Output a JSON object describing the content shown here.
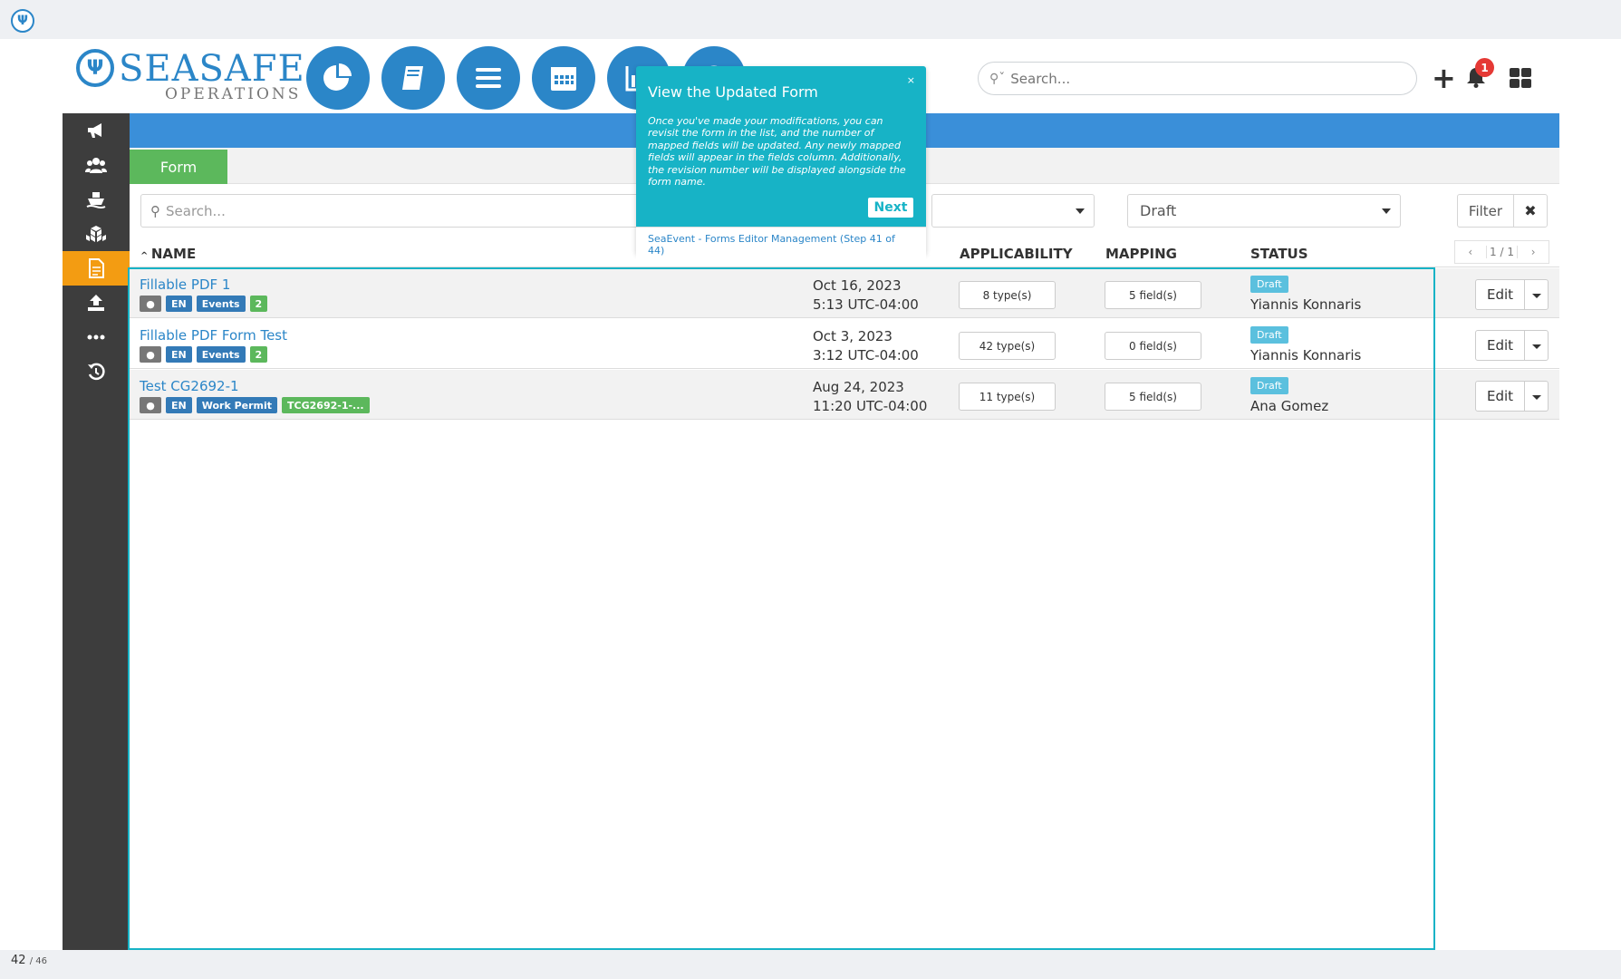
{
  "brand": {
    "name": "SEASAFE",
    "subtitle": "OPERATIONS"
  },
  "icons": [
    "dashboard-pie-icon",
    "book-icon",
    "menu-icon",
    "calendar-icon",
    "chart-icon",
    "clock-icon"
  ],
  "header": {
    "search_placeholder": "Search...",
    "notification_count": "1"
  },
  "sidebar": {
    "items": [
      {
        "icon": "megaphone-icon"
      },
      {
        "icon": "users-icon"
      },
      {
        "icon": "ship-icon"
      },
      {
        "icon": "boxes-icon"
      },
      {
        "icon": "document-icon",
        "active": true
      },
      {
        "icon": "upload-icon"
      },
      {
        "icon": "more-icon"
      },
      {
        "icon": "history-icon"
      }
    ]
  },
  "tabs": {
    "form_label": "Form"
  },
  "filters": {
    "search_placeholder": "Search...",
    "status_value": "Draft",
    "filter_label": "Filter",
    "clear_label": "✖"
  },
  "table": {
    "headers": {
      "name": "NAME",
      "applicability": "APPLICABILITY",
      "mapping": "MAPPING",
      "status": "STATUS"
    },
    "pager": {
      "prev": "‹",
      "page": "1 / 1",
      "next": "›"
    },
    "rows": [
      {
        "name": "Fillable PDF 1",
        "tags": [
          "EN",
          "Events",
          "2"
        ],
        "date": "Oct 16, 2023",
        "time": "5:13 UTC-04:00",
        "applicability": "8 type(s)",
        "mapping": "5 field(s)",
        "status": "Draft",
        "person": "Yiannis Konnaris",
        "edit_label": "Edit"
      },
      {
        "name": "Fillable PDF Form Test",
        "tags": [
          "EN",
          "Events",
          "2"
        ],
        "date": "Oct 3, 2023",
        "time": "3:12 UTC-04:00",
        "applicability": "42 type(s)",
        "mapping": "0 field(s)",
        "status": "Draft",
        "person": "Yiannis Konnaris",
        "edit_label": "Edit"
      },
      {
        "name": "Test CG2692-1",
        "tags": [
          "EN",
          "Work Permit",
          "TCG2692-1-..."
        ],
        "date": "Aug 24, 2023",
        "time": "11:20 UTC-04:00",
        "applicability": "11 type(s)",
        "mapping": "5 field(s)",
        "status": "Draft",
        "person": "Ana Gomez",
        "edit_label": "Edit"
      }
    ]
  },
  "popover": {
    "title": "View the Updated Form",
    "close": "×",
    "body": "Once you've made your modifications, you can revisit the form in the list, and the number of mapped fields will be updated. Any newly mapped fields will appear in the fields column. Additionally, the revision number will be displayed alongside the form name.",
    "next_label": "Next",
    "footer": "SeaEvent - Forms Editor Management (Step 41 of 44)"
  },
  "footer": {
    "page": "42",
    "total": "/ 46"
  },
  "colors": {
    "primary": "#2b86c8",
    "accent": "#17b3c6",
    "active_sidebar": "#f39c12",
    "tab_green": "#5cb85c"
  }
}
